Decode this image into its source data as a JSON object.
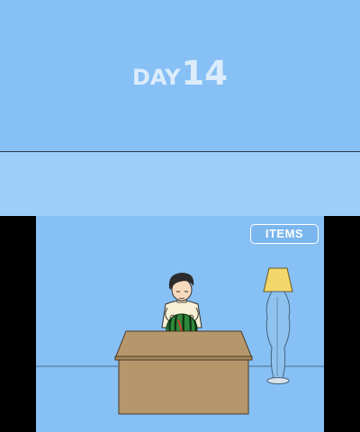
{
  "top_screen": {
    "day_prefix": "DAY",
    "day_number": "14"
  },
  "scene": {
    "items_button_label": "ITEMS"
  },
  "colors": {
    "sky": "#87c0f5",
    "band": "#9ccefa",
    "desk": "#b6976c",
    "watermelon": "#2e8a3a",
    "lamp_shade": "#f3d76a"
  },
  "icons": {
    "character": "boy-character",
    "watermelon": "watermelon-icon",
    "lamp": "floor-lamp-icon",
    "desk": "desk-icon"
  }
}
